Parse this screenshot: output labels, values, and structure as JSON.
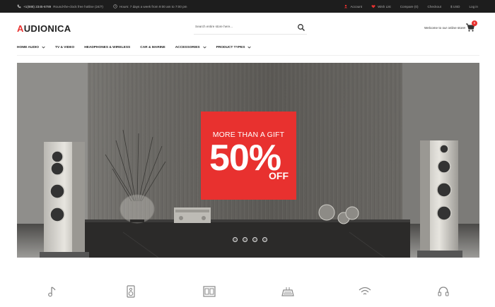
{
  "topbar": {
    "phone": "+1(888) 2345-6789",
    "phone_note": "Round-the-clock free hotline (24/7)",
    "hours": "Hours: 7 days a week from 9:00 am to 7:00 pm",
    "links": [
      "Account",
      "Wish List",
      "Compare (0)",
      "Checkout",
      "Log in"
    ],
    "currency": "$ USD",
    "accent_color": "#e8312f"
  },
  "header": {
    "logo_first": "A",
    "logo_rest": "UDIONICA",
    "search_placeholder": "Search entire store here...",
    "welcome": "Welcome to our online store!",
    "cart_count": "0"
  },
  "nav": {
    "items": [
      {
        "label": "HOME AUDIO",
        "has_menu": true
      },
      {
        "label": "TV & VIDEO",
        "has_menu": false
      },
      {
        "label": "HEADPHONES & WIRELESS",
        "has_menu": false
      },
      {
        "label": "CAR & MARINE",
        "has_menu": false
      },
      {
        "label": "ACCESSORIES",
        "has_menu": true
      },
      {
        "label": "PRODUCT TYPES",
        "has_menu": true
      }
    ]
  },
  "hero": {
    "promo_line1": "MORE THAN A GIFT",
    "promo_big": "50%",
    "promo_off": "OFF",
    "slide_count": 4,
    "active_slide": 1
  },
  "features": {
    "icons": [
      "music-note-icon",
      "speaker-icon",
      "stereo-icon",
      "keyboard-icon",
      "wifi-icon",
      "headphones-icon"
    ]
  }
}
